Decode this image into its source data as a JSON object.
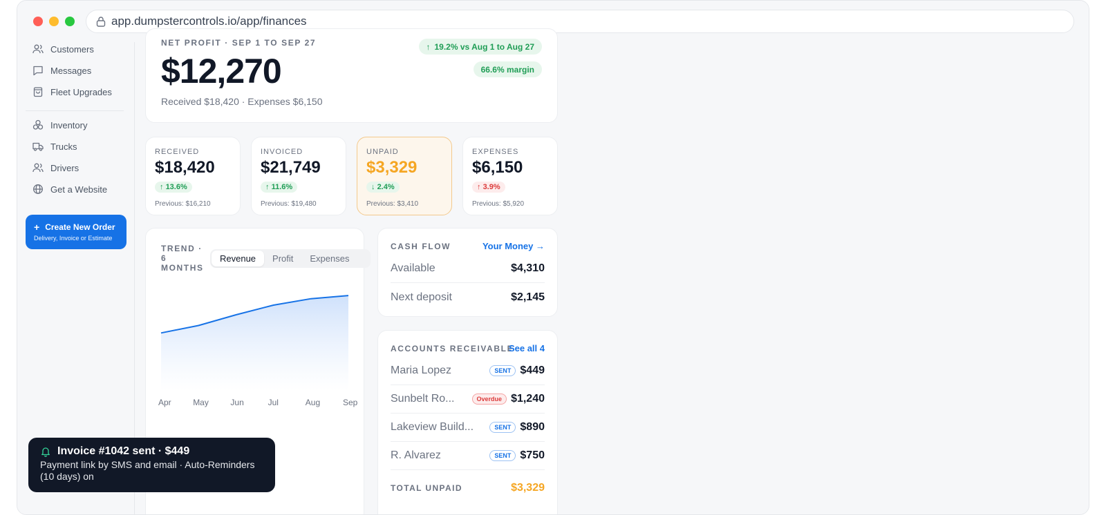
{
  "browser": {
    "url": "app.dumpstercontrols.io/app/finances"
  },
  "sidebar": {
    "items": [
      {
        "label": "Customers",
        "icon": "users-icon"
      },
      {
        "label": "Messages",
        "icon": "message-icon"
      },
      {
        "label": "Fleet Upgrades",
        "icon": "shopping-bag-icon"
      },
      {
        "label": "Inventory",
        "icon": "boxes-icon"
      },
      {
        "label": "Trucks",
        "icon": "truck-icon"
      },
      {
        "label": "Drivers",
        "icon": "users-icon"
      },
      {
        "label": "Get a Website",
        "icon": "globe-icon"
      }
    ],
    "create": {
      "plus": "+",
      "title": "Create New Order",
      "subtitle": "Delivery, Invoice or Estimate"
    }
  },
  "hero": {
    "label": "NET PROFIT · SEP 1 TO SEP 27",
    "value": "$12,270",
    "sub": "Received $18,420 · Expenses $6,150",
    "change_arrow": "↑",
    "change": "19.2% vs Aug 1 to Aug 27",
    "margin": "66.6% margin"
  },
  "stats": [
    {
      "label": "RECEIVED",
      "value": "$18,420",
      "arrow": "↑",
      "change": "13.6%",
      "previous": "Previous: $16,210"
    },
    {
      "label": "INVOICED",
      "value": "$21,749",
      "arrow": "↑",
      "change": "11.6%",
      "previous": "Previous: $19,480"
    },
    {
      "label": "UNPAID",
      "value": "$3,329",
      "arrow": "↓",
      "change": "2.4%",
      "previous": "Previous: $3,410"
    },
    {
      "label": "EXPENSES",
      "value": "$6,150",
      "arrow": "↑",
      "change": "3.9%",
      "previous": "Previous: $5,920"
    }
  ],
  "trend": {
    "label": "TREND · 6 MONTHS",
    "tabs": [
      "Revenue",
      "Profit",
      "Expenses"
    ],
    "active_tab": "Revenue"
  },
  "chart_data": {
    "type": "area",
    "title": "",
    "categories": [
      "Apr",
      "May",
      "Jun",
      "Jul",
      "Aug",
      "Sep"
    ],
    "series": [
      {
        "values": [
          0.54,
          0.61,
          0.71,
          0.8,
          0.86,
          0.89
        ]
      }
    ],
    "ylim": [
      0,
      1
    ],
    "xlabel": "",
    "ylabel": "",
    "grid": false,
    "color": "#1672e6"
  },
  "cashflow": {
    "title": "CASH FLOW",
    "link": "Your Money →",
    "rows": [
      {
        "name": "Available",
        "amount": "$4,310"
      },
      {
        "name": "Next deposit",
        "amount": "$2,145"
      }
    ]
  },
  "receivable": {
    "title": "ACCOUNTS RECEIVABLE",
    "link": "See all 4",
    "rows": [
      {
        "name": "Maria Lopez",
        "badge": "SENT",
        "amount": "$449"
      },
      {
        "name": "Sunbelt Ro...",
        "badge": "Overdue",
        "amount": "$1,240"
      },
      {
        "name": "Lakeview Build...",
        "badge": "SENT",
        "amount": "$890"
      },
      {
        "name": "R. Alvarez",
        "badge": "SENT",
        "amount": "$750"
      }
    ],
    "total_label": "TOTAL UNPAID",
    "total_value": "$3,329"
  },
  "toast": {
    "title": "Invoice #1042 sent · $449",
    "body": "Payment link by SMS and email · Auto-Reminders (10 days) on"
  },
  "colors": {
    "accent": "#1672e6",
    "positive": "#1f9d55",
    "negative": "#dc3a3a",
    "warning": "#f5a623"
  }
}
